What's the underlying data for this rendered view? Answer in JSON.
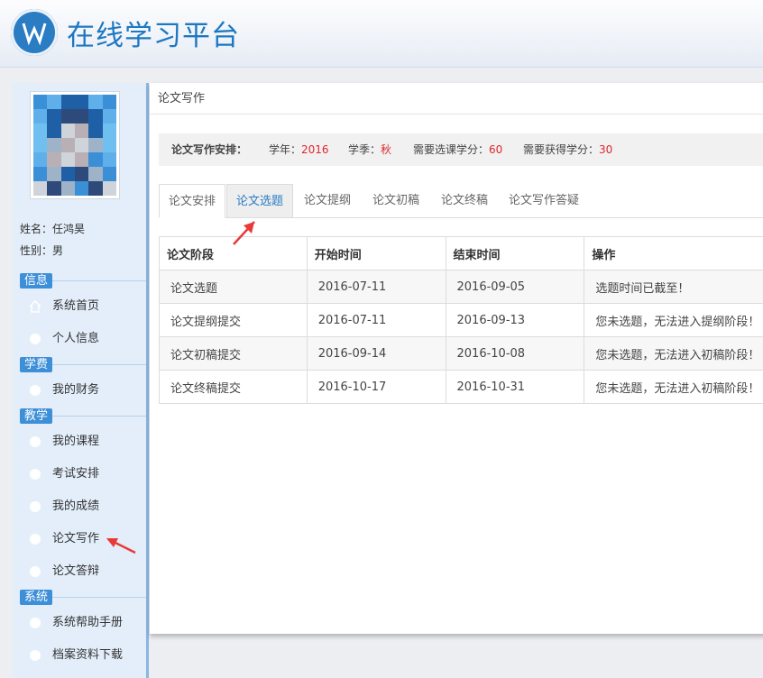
{
  "header": {
    "title": "在线学习平台"
  },
  "profile": {
    "name_line": "姓名：任鸿昊",
    "gender_line": "性别：男"
  },
  "sidebar": {
    "sections": [
      {
        "label": "信息",
        "items": [
          {
            "label": "系统首页",
            "icon": "home-icon"
          },
          {
            "label": "个人信息",
            "icon": "circle-icon"
          }
        ]
      },
      {
        "label": "学费",
        "items": [
          {
            "label": "我的财务",
            "icon": "circle-icon"
          }
        ]
      },
      {
        "label": "教学",
        "items": [
          {
            "label": "我的课程",
            "icon": "circle-icon"
          },
          {
            "label": "考试安排",
            "icon": "circle-icon"
          },
          {
            "label": "我的成绩",
            "icon": "circle-icon"
          },
          {
            "label": "论文写作",
            "icon": "circle-icon"
          },
          {
            "label": "论文答辩",
            "icon": "circle-icon"
          }
        ]
      },
      {
        "label": "系统",
        "items": [
          {
            "label": "系统帮助手册",
            "icon": "circle-icon"
          },
          {
            "label": "档案资料下载",
            "icon": "circle-icon"
          }
        ]
      }
    ]
  },
  "main": {
    "breadcrumb": "论文写作",
    "schedule": {
      "label": "论文写作安排：",
      "year_label": "学年：",
      "year_value": "2016",
      "season_label": "学季：",
      "season_value": "秋",
      "required_credits_label": "需要选课学分：",
      "required_credits_value": "60",
      "earned_credits_label": "需要获得学分：",
      "earned_credits_value": "30"
    },
    "tabs": [
      "论文安排",
      "论文选题",
      "论文提纲",
      "论文初稿",
      "论文终稿",
      "论文写作答疑"
    ],
    "table": {
      "headers": [
        "论文阶段",
        "开始时间",
        "结束时间",
        "操作"
      ],
      "rows": [
        [
          "论文选题",
          "2016-07-11",
          "2016-09-05",
          "选题时间已截至！"
        ],
        [
          "论文提纲提交",
          "2016-07-11",
          "2016-09-13",
          "您未选题，无法进入提纲阶段！"
        ],
        [
          "论文初稿提交",
          "2016-09-14",
          "2016-10-08",
          "您未选题，无法进入初稿阶段！"
        ],
        [
          "论文终稿提交",
          "2016-10-17",
          "2016-10-31",
          "您未选题，无法进入初稿阶段！"
        ]
      ]
    }
  },
  "colors": {
    "accent": "#1d78c2",
    "section_bg": "#3d8fd8",
    "highlight_red": "#e0262b"
  }
}
